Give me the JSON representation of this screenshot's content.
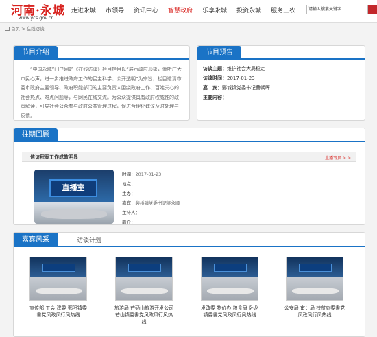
{
  "header": {
    "logo": "河南·永城",
    "site_url": "www.ycs.gov.cn",
    "nav": [
      {
        "label": "走进永城",
        "active": false
      },
      {
        "label": "市领导",
        "active": false
      },
      {
        "label": "资讯中心",
        "active": false
      },
      {
        "label": "智慧政府",
        "active": true
      },
      {
        "label": "乐享永城",
        "active": false
      },
      {
        "label": "投资永城",
        "active": false
      },
      {
        "label": "服务三农",
        "active": false
      }
    ],
    "search_value": "请输入搜索关键字"
  },
  "breadcrumb": {
    "home": "首页",
    "sep": ">",
    "current": "在线访谈"
  },
  "intro": {
    "title": "节目介绍",
    "text": "“中国永城”门户网站《在线访谈》栏目栏目以“展示政府形象，倾听广大市民心声，进一步推进政府工作的民主科学、公开透明”为宗旨，栏目邀请市委市政府主要领导、政府职能部门的主要负责人围绕政府工作、百姓关心的社会热点、难点问题等，与网民在线交流。为公众提供具有政府权威性的政策解读，引导社会公众参与政府公共管理过程，促进合理化建议及时处理与反馈。"
  },
  "preview": {
    "title": "节目预告",
    "rows": [
      {
        "label": "访谈主题：",
        "value": "维护社会大局稳定"
      },
      {
        "label": "访谈时间：",
        "value": "2017-01-23"
      },
      {
        "label": "嘉　宾：",
        "value": "鄄城镇党委书记曹朝晖"
      },
      {
        "label": "主要内容：",
        "value": ""
      }
    ]
  },
  "past": {
    "title": "往期回顾",
    "item_title": "信访积案工作成效明显",
    "more": "直播专页 > >",
    "screen_text": "直播室",
    "meta": [
      {
        "label": "时间：",
        "value": "2017-01-23"
      },
      {
        "label": "地点：",
        "value": ""
      },
      {
        "label": "主办：",
        "value": ""
      },
      {
        "label": "嘉宾：",
        "value": "裴桥镇党委书记梁永顺"
      },
      {
        "label": "主持人：",
        "value": ""
      },
      {
        "label": "简介：",
        "value": ""
      }
    ]
  },
  "guests": {
    "tab1": "嘉宾风采",
    "tab2": "访谈计划",
    "cards": [
      {
        "caption": "宣传部 工会 建委 鄄阳镇委 書党风政风行风热线"
      },
      {
        "caption": "旅游局 芒砀山旅游开发公司 芒山镇委書党风政风行风热线"
      },
      {
        "caption": "发改委 物价办 粮食局 卧龙镇委書党风政风行风热线"
      },
      {
        "caption": "公安局 审计局 扶贫办委書党风政风行风热线"
      }
    ]
  }
}
